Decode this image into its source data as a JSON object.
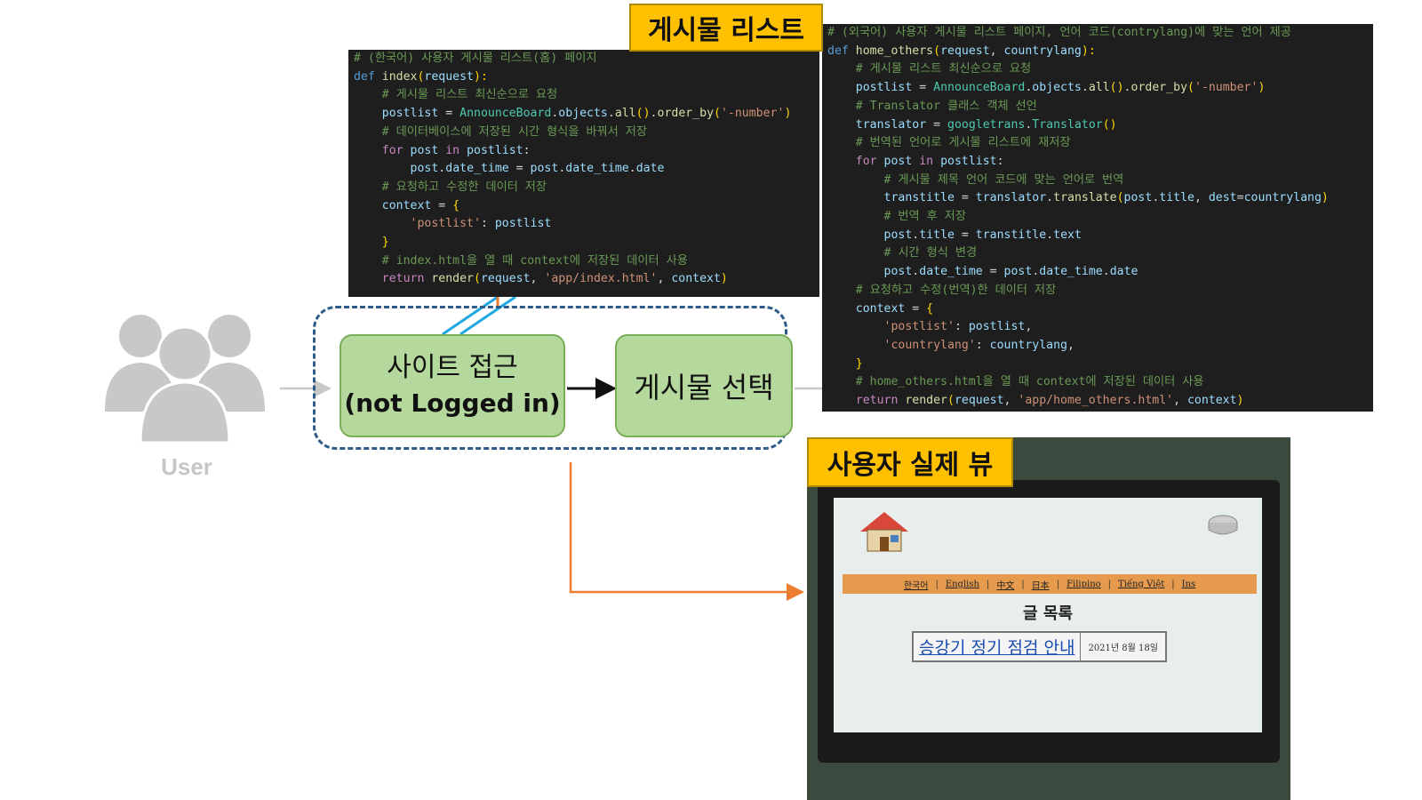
{
  "user": {
    "icon": "user-group-icon",
    "label": "User"
  },
  "flow": {
    "node1": {
      "line1": "사이트 접근",
      "line2": "(not Logged in)"
    },
    "node2": {
      "label": "게시물 선택"
    }
  },
  "tags": {
    "post_list": "게시물 리스트",
    "user_view": "사용자 실제 뷰"
  },
  "code_korean": [
    [
      [
        "c-cm",
        "# (한국어) 사용자 게시물 리스트(홈) 페이지"
      ]
    ],
    [
      [
        "c-kw",
        "def "
      ],
      [
        "c-fn",
        "index"
      ],
      [
        "c-br",
        "("
      ],
      [
        "c-var",
        "request"
      ],
      [
        "c-br",
        "):"
      ]
    ],
    [
      [
        "c-op",
        "    "
      ],
      [
        "c-cm",
        "# 게시물 리스트 최신순으로 요청"
      ]
    ],
    [
      [
        "c-op",
        "    "
      ],
      [
        "c-var",
        "postlist"
      ],
      [
        "c-op",
        " = "
      ],
      [
        "c-cls",
        "AnnounceBoard"
      ],
      [
        "c-op",
        "."
      ],
      [
        "c-var",
        "objects"
      ],
      [
        "c-op",
        "."
      ],
      [
        "c-fn",
        "all"
      ],
      [
        "c-br",
        "()"
      ],
      [
        "c-op",
        "."
      ],
      [
        "c-fn",
        "order_by"
      ],
      [
        "c-br",
        "("
      ],
      [
        "c-str",
        "'-number'"
      ],
      [
        "c-br",
        ")"
      ]
    ],
    [
      [
        "c-op",
        "    "
      ],
      [
        "c-cm",
        "# 데이터베이스에 저장된 시간 형식을 바꿔서 저장"
      ]
    ],
    [
      [
        "c-op",
        "    "
      ],
      [
        "c-ctl",
        "for "
      ],
      [
        "c-var",
        "post"
      ],
      [
        "c-ctl",
        " in "
      ],
      [
        "c-var",
        "postlist"
      ],
      [
        "c-op",
        ":"
      ]
    ],
    [
      [
        "c-op",
        "        "
      ],
      [
        "c-var",
        "post"
      ],
      [
        "c-op",
        "."
      ],
      [
        "c-var",
        "date_time"
      ],
      [
        "c-op",
        " = "
      ],
      [
        "c-var",
        "post"
      ],
      [
        "c-op",
        "."
      ],
      [
        "c-var",
        "date_time"
      ],
      [
        "c-op",
        "."
      ],
      [
        "c-var",
        "date"
      ]
    ],
    [
      [
        "c-op",
        "    "
      ],
      [
        "c-cm",
        "# 요청하고 수정한 데이터 저장"
      ]
    ],
    [
      [
        "c-op",
        "    "
      ],
      [
        "c-var",
        "context"
      ],
      [
        "c-op",
        " = "
      ],
      [
        "c-br",
        "{"
      ]
    ],
    [
      [
        "c-op",
        "        "
      ],
      [
        "c-str",
        "'postlist'"
      ],
      [
        "c-op",
        ": "
      ],
      [
        "c-var",
        "postlist"
      ]
    ],
    [
      [
        "c-op",
        "    "
      ],
      [
        "c-br",
        "}"
      ]
    ],
    [
      [
        "c-op",
        "    "
      ],
      [
        "c-cm",
        "# index.html을 열 때 context에 저장된 데이터 사용"
      ]
    ],
    [
      [
        "c-op",
        "    "
      ],
      [
        "c-ctl",
        "return "
      ],
      [
        "c-fn",
        "render"
      ],
      [
        "c-br",
        "("
      ],
      [
        "c-var",
        "request"
      ],
      [
        "c-op",
        ", "
      ],
      [
        "c-str",
        "'app/index.html'"
      ],
      [
        "c-op",
        ", "
      ],
      [
        "c-var",
        "context"
      ],
      [
        "c-br",
        ")"
      ]
    ]
  ],
  "code_foreign": [
    [
      [
        "c-cm",
        "# (외국어) 사용자 게시물 리스트 페이지, 언어 코드(contrylang)에 맞는 언어 제공"
      ]
    ],
    [
      [
        "c-kw",
        "def "
      ],
      [
        "c-fn",
        "home_others"
      ],
      [
        "c-br",
        "("
      ],
      [
        "c-var",
        "request"
      ],
      [
        "c-op",
        ", "
      ],
      [
        "c-var",
        "countrylang"
      ],
      [
        "c-br",
        "):"
      ]
    ],
    [
      [
        "c-op",
        "    "
      ],
      [
        "c-cm",
        "# 게시물 리스트 최신순으로 요청"
      ]
    ],
    [
      [
        "c-op",
        "    "
      ],
      [
        "c-var",
        "postlist"
      ],
      [
        "c-op",
        " = "
      ],
      [
        "c-cls",
        "AnnounceBoard"
      ],
      [
        "c-op",
        "."
      ],
      [
        "c-var",
        "objects"
      ],
      [
        "c-op",
        "."
      ],
      [
        "c-fn",
        "all"
      ],
      [
        "c-br",
        "()"
      ],
      [
        "c-op",
        "."
      ],
      [
        "c-fn",
        "order_by"
      ],
      [
        "c-br",
        "("
      ],
      [
        "c-str",
        "'-number'"
      ],
      [
        "c-br",
        ")"
      ]
    ],
    [
      [
        "c-op",
        "    "
      ],
      [
        "c-cm",
        "# Translator 클래스 객체 선언"
      ]
    ],
    [
      [
        "c-op",
        "    "
      ],
      [
        "c-var",
        "translator"
      ],
      [
        "c-op",
        " = "
      ],
      [
        "c-cls",
        "googletrans"
      ],
      [
        "c-op",
        "."
      ],
      [
        "c-cls",
        "Translator"
      ],
      [
        "c-br",
        "()"
      ]
    ],
    [
      [
        "c-op",
        "    "
      ],
      [
        "c-cm",
        "# 번역된 언어로 게시물 리스트에 재저장"
      ]
    ],
    [
      [
        "c-op",
        "    "
      ],
      [
        "c-ctl",
        "for "
      ],
      [
        "c-var",
        "post"
      ],
      [
        "c-ctl",
        " in "
      ],
      [
        "c-var",
        "postlist"
      ],
      [
        "c-op",
        ":"
      ]
    ],
    [
      [
        "c-op",
        "        "
      ],
      [
        "c-cm",
        "# 게시물 제목 언어 코드에 맞는 언어로 번역"
      ]
    ],
    [
      [
        "c-op",
        "        "
      ],
      [
        "c-var",
        "transtitle"
      ],
      [
        "c-op",
        " = "
      ],
      [
        "c-var",
        "translator"
      ],
      [
        "c-op",
        "."
      ],
      [
        "c-fn",
        "translate"
      ],
      [
        "c-br",
        "("
      ],
      [
        "c-var",
        "post"
      ],
      [
        "c-op",
        "."
      ],
      [
        "c-var",
        "title"
      ],
      [
        "c-op",
        ", "
      ],
      [
        "c-var",
        "dest"
      ],
      [
        "c-op",
        "="
      ],
      [
        "c-var",
        "countrylang"
      ],
      [
        "c-br",
        ")"
      ]
    ],
    [
      [
        "c-op",
        "        "
      ],
      [
        "c-cm",
        "# 번역 후 저장"
      ]
    ],
    [
      [
        "c-op",
        "        "
      ],
      [
        "c-var",
        "post"
      ],
      [
        "c-op",
        "."
      ],
      [
        "c-var",
        "title"
      ],
      [
        "c-op",
        " = "
      ],
      [
        "c-var",
        "transtitle"
      ],
      [
        "c-op",
        "."
      ],
      [
        "c-var",
        "text"
      ]
    ],
    [
      [
        "c-op",
        "        "
      ],
      [
        "c-cm",
        "# 시간 형식 변경"
      ]
    ],
    [
      [
        "c-op",
        "        "
      ],
      [
        "c-var",
        "post"
      ],
      [
        "c-op",
        "."
      ],
      [
        "c-var",
        "date_time"
      ],
      [
        "c-op",
        " = "
      ],
      [
        "c-var",
        "post"
      ],
      [
        "c-op",
        "."
      ],
      [
        "c-var",
        "date_time"
      ],
      [
        "c-op",
        "."
      ],
      [
        "c-var",
        "date"
      ]
    ],
    [
      [
        "c-op",
        "    "
      ],
      [
        "c-cm",
        "# 요청하고 수정(번역)한 데이터 저장"
      ]
    ],
    [
      [
        "c-op",
        "    "
      ],
      [
        "c-var",
        "context"
      ],
      [
        "c-op",
        " = "
      ],
      [
        "c-br",
        "{"
      ]
    ],
    [
      [
        "c-op",
        "        "
      ],
      [
        "c-str",
        "'postlist'"
      ],
      [
        "c-op",
        ": "
      ],
      [
        "c-var",
        "postlist"
      ],
      [
        "c-op",
        ","
      ]
    ],
    [
      [
        "c-op",
        "        "
      ],
      [
        "c-str",
        "'countrylang'"
      ],
      [
        "c-op",
        ": "
      ],
      [
        "c-var",
        "countrylang"
      ],
      [
        "c-op",
        ","
      ]
    ],
    [
      [
        "c-op",
        "    "
      ],
      [
        "c-br",
        "}"
      ]
    ],
    [
      [
        "c-op",
        "    "
      ],
      [
        "c-cm",
        "# home_others.html을 열 때 context에 저장된 데이터 사용"
      ]
    ],
    [
      [
        "c-op",
        "    "
      ],
      [
        "c-ctl",
        "return "
      ],
      [
        "c-fn",
        "render"
      ],
      [
        "c-br",
        "("
      ],
      [
        "c-var",
        "request"
      ],
      [
        "c-op",
        ", "
      ],
      [
        "c-str",
        "'app/home_others.html'"
      ],
      [
        "c-op",
        ", "
      ],
      [
        "c-var",
        "context"
      ],
      [
        "c-br",
        ")"
      ]
    ]
  ],
  "screen": {
    "nav": [
      "한국어",
      "English",
      "中文",
      "日本",
      "Filipino",
      "Tiếng Việt",
      "Ins"
    ],
    "board_title": "글 목록",
    "post_title": "승강기 정기 점검 안내",
    "post_date": "2021년 8월 18일",
    "home_icon": "home-icon",
    "gear_icon": "gear-icon"
  },
  "colors": {
    "node_fill": "#b5d99c",
    "node_border": "#7aae5a",
    "dashed_border": "#2e5b8a",
    "tag_fill": "#ffc000",
    "arrow_orange": "#ed7d31",
    "arrow_blue": "#1ea7e0",
    "arrow_gray": "#c8c8c8"
  }
}
